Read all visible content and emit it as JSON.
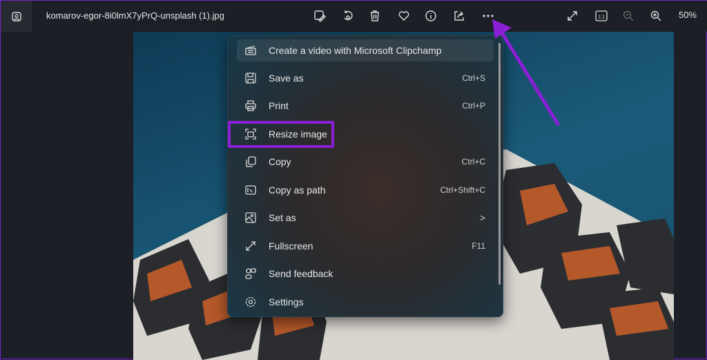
{
  "topbar": {
    "filename": "komarov-egor-8i0lmX7yPrQ-unsplash (1).jpg",
    "zoom": "50%",
    "tools": [
      "edit-icon",
      "rotate-icon",
      "delete-icon",
      "heart-icon",
      "info-icon",
      "share-icon",
      "more-icon"
    ],
    "right_tools": [
      "fullscreen-icon",
      "actual-size-icon",
      "zoom-out-icon",
      "zoom-in-icon"
    ],
    "actual_size_label": "1:1"
  },
  "menu": {
    "items": [
      {
        "label": "Create a video with Microsoft Clipchamp",
        "shortcut": "",
        "icon": "clipchamp-icon"
      },
      {
        "label": "Save as",
        "shortcut": "Ctrl+S",
        "icon": "save-icon"
      },
      {
        "label": "Print",
        "shortcut": "Ctrl+P",
        "icon": "print-icon"
      },
      {
        "label": "Resize image",
        "shortcut": "",
        "icon": "resize-icon"
      },
      {
        "label": "Copy",
        "shortcut": "Ctrl+C",
        "icon": "copy-icon"
      },
      {
        "label": "Copy as path",
        "shortcut": "Ctrl+Shift+C",
        "icon": "copy-path-icon"
      },
      {
        "label": "Set as",
        "shortcut": "",
        "icon": "set-as-icon",
        "submenu": ">"
      },
      {
        "label": "Fullscreen",
        "shortcut": "F11",
        "icon": "fullscreen-icon"
      },
      {
        "label": "Send feedback",
        "shortcut": "",
        "icon": "feedback-icon"
      },
      {
        "label": "Settings",
        "shortcut": "",
        "icon": "settings-icon"
      }
    ]
  },
  "colors": {
    "highlight": "#8a1fd6",
    "background": "#1c1f26"
  }
}
